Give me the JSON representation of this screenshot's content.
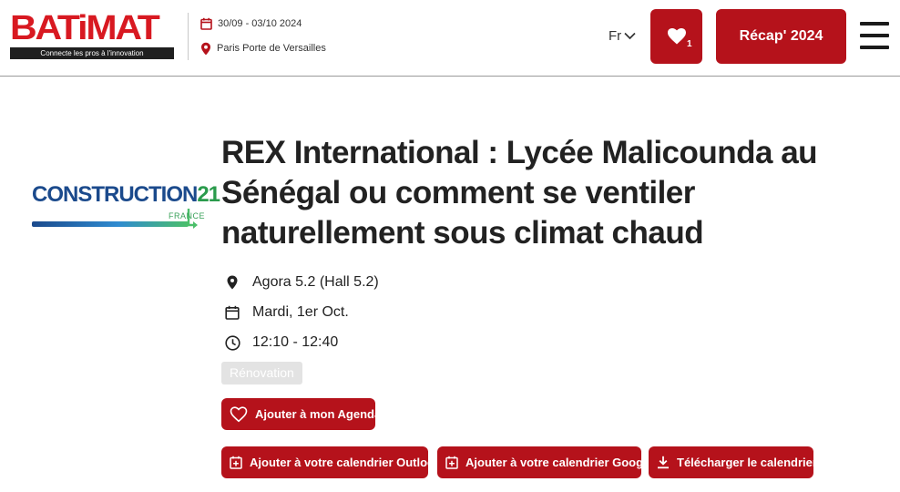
{
  "header": {
    "logo_text": "BATiMAT",
    "logo_tagline": "Connecte les pros à l'innovation",
    "dates": "30/09 - 03/10 2024",
    "location": "Paris Porte de Versailles",
    "language": "Fr",
    "favorites_count": "1",
    "recap_label": "Récap' 2024"
  },
  "sponsor": {
    "name_part1": "CONSTRUCTION",
    "name_part2": "21",
    "country": "FRANCE"
  },
  "event": {
    "title": "REX International : Lycée Malicounda au Sénégal ou comment se ventiler naturellement sous climat chaud",
    "place": "Agora 5.2 (Hall 5.2)",
    "date": "Mardi, 1er Oct.",
    "time": "12:10 - 12:40",
    "tag": "Rénovation"
  },
  "actions": {
    "agenda_label": "Ajouter à mon Agenda",
    "outlook_label": "Ajouter à votre calendrier Outlook",
    "google_label": "Ajouter à votre calendrier Google",
    "download_label": "Télécharger le calendrier"
  },
  "colors": {
    "brand_red": "#b5121b",
    "logo_red": "#d81921"
  }
}
